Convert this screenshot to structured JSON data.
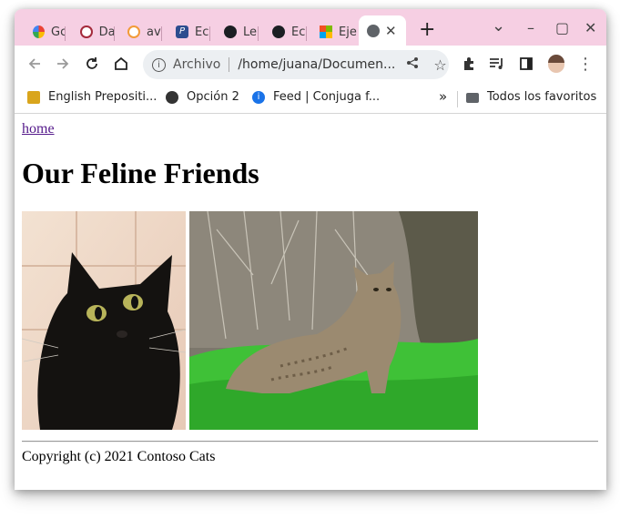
{
  "browser": {
    "tabs": [
      {
        "label": "Gc",
        "icon": "google-icon"
      },
      {
        "label": "Da",
        "icon": "shield-icon"
      },
      {
        "label": "av",
        "icon": "orange-circle-icon"
      },
      {
        "label": "Ec",
        "icon": "p-logo-icon"
      },
      {
        "label": "Le",
        "icon": "github-icon"
      },
      {
        "label": "Ec",
        "icon": "github-icon"
      },
      {
        "label": "Eje",
        "icon": "microsoft-icon"
      }
    ],
    "active_tab": {
      "icon": "globe-icon",
      "close": "✕"
    },
    "new_tab": "+",
    "controls": {
      "dropdown": "⌄",
      "minimize": "–",
      "maximize": "▢",
      "close": "✕"
    },
    "address": {
      "scheme_label": "Archivo",
      "url": "/home/juana/Documen..."
    },
    "bookmarks": [
      {
        "label": "English Prepositi...",
        "icon": "book-icon"
      },
      {
        "label": "Opción 2",
        "icon": "globe-icon"
      },
      {
        "label": "Feed | Conjuga f...",
        "icon": "info-icon"
      }
    ],
    "bookmarks_more": "»",
    "all_bookmarks": "Todos los favoritos"
  },
  "page": {
    "home_link": "home",
    "title": "Our Feline Friends",
    "images": [
      "black-cat-photo",
      "bobcat-photo"
    ],
    "footer": "Copyright (c) 2021 Contoso Cats"
  },
  "colors": {
    "tabbar_bg": "#f6cfe3",
    "link": "#551a8b"
  }
}
